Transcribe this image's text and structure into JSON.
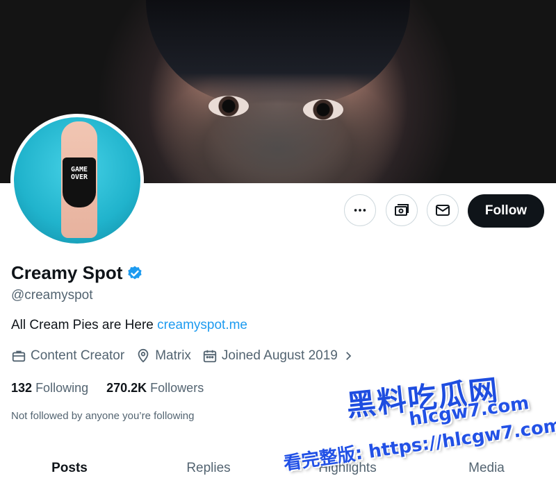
{
  "profile": {
    "name": "Creamy Spot",
    "handle": "@creamyspot",
    "bio_text": "All Cream Pies are Here ",
    "bio_link": "creamyspot.me",
    "category": "Content Creator",
    "location": "Matrix",
    "joined": "Joined August 2019",
    "following_count": "132",
    "following_label": "Following",
    "followers_count": "270.2K",
    "followers_label": "Followers",
    "not_followed_text": "Not followed by anyone you’re following",
    "avatar_text": "GAME OVER"
  },
  "actions": {
    "more_icon": "more-horizontal-icon",
    "subscribe_icon": "money-icon",
    "message_icon": "envelope-icon",
    "follow_label": "Follow"
  },
  "tabs": [
    {
      "label": "Posts",
      "active": true
    },
    {
      "label": "Replies",
      "active": false
    },
    {
      "label": "Highlights",
      "active": false
    },
    {
      "label": "Media",
      "active": false
    }
  ],
  "watermark": {
    "line1": "黑料吃瓜网",
    "line2": "hlcgw7.com",
    "line3": "看完整版: https://hlcgw7.com"
  },
  "colors": {
    "accent": "#1d9bf0",
    "follow_bg": "#0f1419",
    "muted_text": "#536471",
    "verified": "#1d9bf0"
  }
}
